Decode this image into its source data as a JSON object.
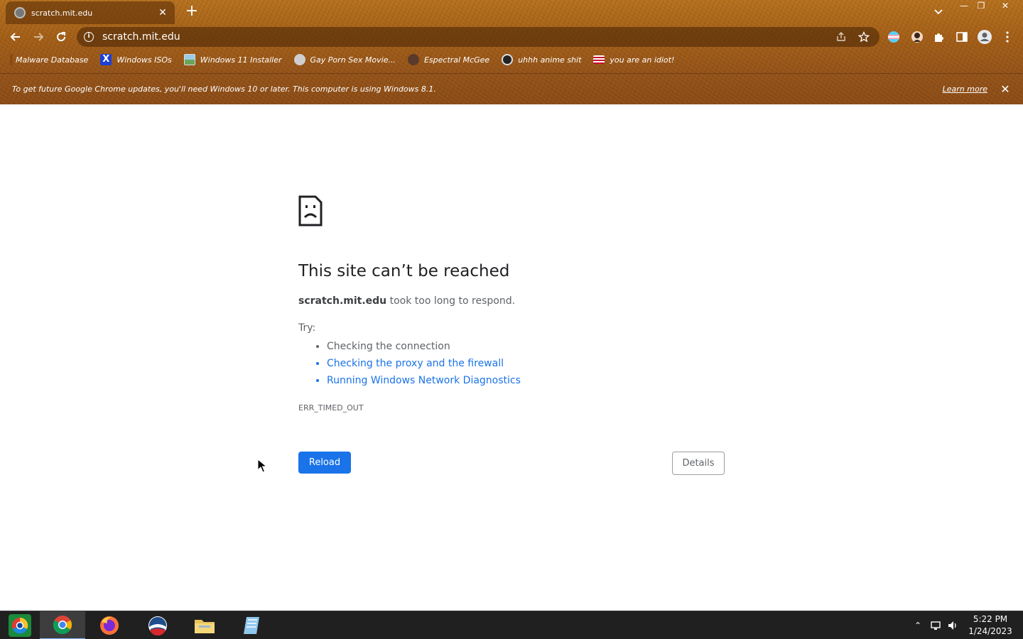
{
  "browser": {
    "tab": {
      "title": "scratch.mit.edu",
      "close": "✕"
    },
    "new_tab": "+",
    "window_controls": {
      "minimize": "—",
      "maximize": "❐",
      "close": "✕"
    },
    "omnibox": {
      "url": "scratch.mit.edu",
      "info": "i"
    },
    "bookmarks": [
      {
        "label": "Malware Database",
        "icon": "malware-icon",
        "color": "#8a4a14"
      },
      {
        "label": "Windows ISOs",
        "icon": "x-icon",
        "color": "#1d3fd6"
      },
      {
        "label": "Windows 11 Installer",
        "icon": "image-icon",
        "color": "#6aa55a"
      },
      {
        "label": "Gay Porn Sex Movie...",
        "icon": "avatar-icon",
        "color": "#cfcfcf"
      },
      {
        "label": "Espectral McGee",
        "icon": "avatar-icon",
        "color": "#5a3a2a"
      },
      {
        "label": "uhhh anime shit",
        "icon": "avatar-icon",
        "color": "#222222"
      },
      {
        "label": "you are an idiot!",
        "icon": "flag-icon",
        "color": "#c8102e"
      }
    ],
    "infobar": {
      "message": "To get future Google Chrome updates, you'll need Windows 10 or later. This computer is using Windows 8.1.",
      "link": "Learn more",
      "close": "✕"
    }
  },
  "error_page": {
    "title": "This site can’t be reached",
    "host": "scratch.mit.edu",
    "message": " took too long to respond.",
    "try_label": "Try:",
    "suggestions": [
      "Checking the connection",
      "Checking the proxy and the firewall",
      "Running Windows Network Diagnostics"
    ],
    "error_code": "ERR_TIMED_OUT",
    "reload_label": "Reload",
    "details_label": "Details",
    "link_color": "#1a73e8",
    "button_color": "#1a73e8"
  },
  "taskbar": {
    "apps": [
      "start",
      "chrome",
      "firefox",
      "obama",
      "file-explorer",
      "notepad"
    ],
    "tray": {
      "show_hidden": "⌃"
    },
    "clock": {
      "time": "5:22 PM",
      "date": "1/24/2023"
    }
  }
}
